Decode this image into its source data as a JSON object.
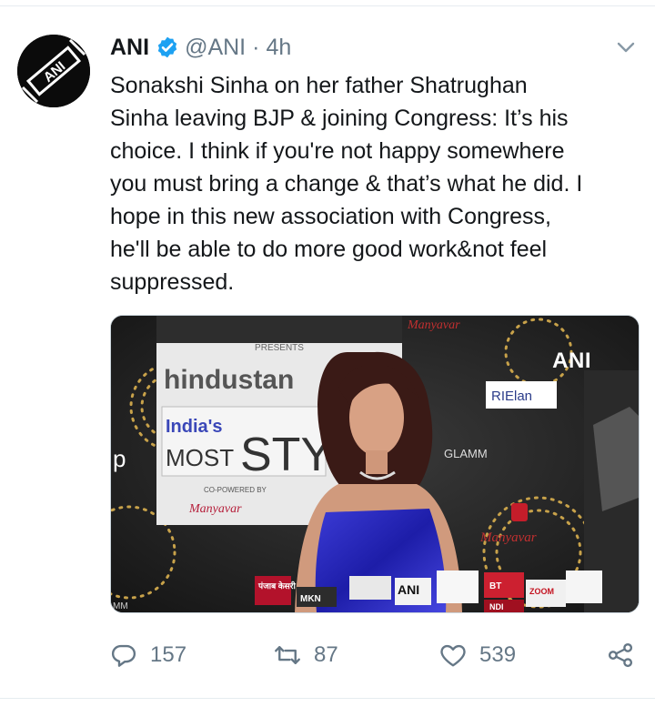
{
  "tweet": {
    "author_name": "ANI",
    "handle": "@ANI",
    "separator": "·",
    "time": "4h",
    "avatar_text": "ANI",
    "text": "Sonakshi Sinha on her father Shatrughan\nSinha leaving BJP & joining Congress: It’s his\nchoice. I think if you're not happy somewhere\nyou must bring a change & that’s what he did. I\nhope in this new association with Congress,\nhe'll be able to do more good work&not feel\nsuppressed.",
    "media": {
      "watermark": "ANI",
      "backdrop_text": {
        "presents": "PRESENTS",
        "brand": "hindustan",
        "indias": "India's",
        "most": "MOST",
        "styl": "STYL",
        "copowered": "CO-POWERED BY",
        "manyavar": "Manyavar",
        "manyavar_top": "Manyavar",
        "manyavar_right": "Manyavar",
        "rielan": "RIElan",
        "glamm": "GLAMM",
        "p": "p",
        "mic1": "पंजाब\nकेसरी",
        "mic2": "MKN",
        "mic3": "ANI",
        "mic4": "BT",
        "mic5": "ZOOM",
        "mic6": "NDI",
        "mm": "MM"
      }
    }
  },
  "actions": {
    "reply_count": "157",
    "retweet_count": "87",
    "like_count": "539"
  },
  "icons": {
    "verified": "verified-badge-icon",
    "chevron": "chevron-down-icon",
    "reply": "reply-icon",
    "retweet": "retweet-icon",
    "like": "heart-icon",
    "share": "share-icon"
  },
  "colors": {
    "accent": "#1da1f2",
    "muted": "#657786",
    "text": "#14171a",
    "divider": "#e6ecf0"
  }
}
